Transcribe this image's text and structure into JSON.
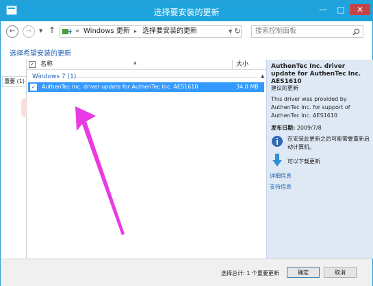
{
  "window": {
    "title": "选择要安装的更新",
    "min_glyph": "—",
    "max_glyph": "□",
    "close_glyph": "✕"
  },
  "address": {
    "crumb_sep": "«",
    "crumb1": "Windows 更新",
    "crumb_arrow": "▸",
    "crumb2": "选择要安装的更新",
    "search_placeholder": "搜索控制面板"
  },
  "heading": "选择希望安装的更新",
  "left_tab": "重要 (1)",
  "list": {
    "col_name": "名称",
    "col_size": "大小",
    "group": "Windows 7 (1)",
    "rows": [
      {
        "name": "AuthenTec Inc. driver update for AuthenTec Inc. AES1610",
        "size": "34.0 MB",
        "checked": true
      }
    ]
  },
  "details": {
    "title": "AuthenTec Inc. driver update for AuthenTec Inc. AES1610",
    "subtitle": "建议的更新",
    "description": "This driver was provided by AuthenTec Inc. for support of AuthenTec Inc. AES1610",
    "date_label": "发布日期:",
    "date_value": "2009/7/8",
    "restart_note": "在安装此更新之后可能需要重新启动计算机。",
    "download_note": "可以下载更新",
    "link_details": "详细信息",
    "link_support": "支持信息"
  },
  "footer": {
    "total": "选择总计: 1 个重要更新",
    "ok_label": "确定",
    "cancel_label": "取消"
  },
  "colors": {
    "titlebar": "#1fa3dd",
    "selection": "#3399ff",
    "details_pane": "#dfe9f5",
    "annotation_arrow": "#e93be3",
    "link": "#1e5fb0"
  }
}
